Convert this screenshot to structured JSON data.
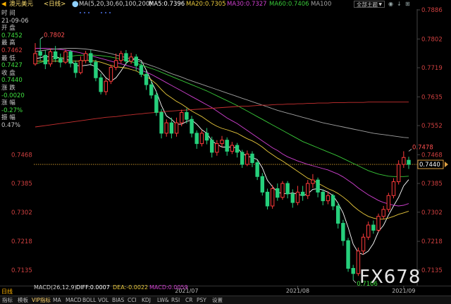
{
  "topbar": {
    "symbol_name": "澳元美元",
    "period_tag": "<日线>",
    "ma_title": "MA(5,20,30,60,100,200)",
    "ma_values": [
      {
        "label": "MA5:0.7396",
        "color": "#ffffff"
      },
      {
        "label": "MA20:0.7305",
        "color": "#e8c83c"
      },
      {
        "label": "MA30:0.7327",
        "color": "#d040d0"
      },
      {
        "label": "MA60:0.7406",
        "color": "#38c838"
      },
      {
        "label": "MA100",
        "color": "#a0a0a0"
      }
    ],
    "menu_button": "全部主题",
    "menu_caret": "▼",
    "icons": [
      "◉",
      "↓",
      "⊞"
    ]
  },
  "info_panel": {
    "lines": [
      {
        "text": "时 间",
        "color": "#c8c8c8"
      },
      {
        "text": "21-09-06",
        "color": "#c8c8c8"
      },
      {
        "text": "开 盘",
        "color": "#c8c8c8"
      },
      {
        "text": "0.7452",
        "color": "#40e040"
      },
      {
        "text": "最 高",
        "color": "#c8c8c8"
      },
      {
        "text": "0.7462",
        "color": "#e04040"
      },
      {
        "text": "最 低",
        "color": "#c8c8c8"
      },
      {
        "text": "0.7427",
        "color": "#40e040"
      },
      {
        "text": "收 盘",
        "color": "#c8c8c8"
      },
      {
        "text": "0.7440",
        "color": "#40e040"
      },
      {
        "text": "涨 跌",
        "color": "#c8c8c8"
      },
      {
        "text": "-0.0020",
        "color": "#40e040"
      },
      {
        "text": "涨 幅",
        "color": "#c8c8c8"
      },
      {
        "text": "-0.27%",
        "color": "#40e040"
      },
      {
        "text": "振 幅",
        "color": "#c8c8c8"
      },
      {
        "text": "0.47%",
        "color": "#c8c8c8"
      }
    ]
  },
  "chart_data": {
    "type": "candlestick",
    "ylim": [
      0.709,
      0.7886
    ],
    "y_ticks": [
      "0.7886",
      "0.7802",
      "0.7719",
      "0.7635",
      "0.7552",
      "0.7468",
      "0.7385",
      "0.7302",
      "0.7218",
      "0.7135"
    ],
    "y_tick_values": [
      0.7886,
      0.7802,
      0.7719,
      0.7635,
      0.7552,
      0.7468,
      0.7385,
      0.7302,
      0.7218,
      0.7135
    ],
    "left_ticks": [
      {
        "value": 0.7468,
        "label": "0.7468"
      },
      {
        "value": 0.7385,
        "label": "0.7385"
      },
      {
        "value": 0.7302,
        "label": "0.7302"
      },
      {
        "value": 0.7218,
        "label": "0.7218"
      },
      {
        "value": 0.7135,
        "label": "0.7135"
      }
    ],
    "x_labels": [
      {
        "label": "2021/07",
        "index": 30
      },
      {
        "label": "2021/08",
        "index": 52
      },
      {
        "label": "2021/09",
        "index": 73
      }
    ],
    "current_price": {
      "value": 0.744,
      "label": "0.7440"
    },
    "annotations": [
      {
        "label": "0.7802",
        "index": 1,
        "value": 0.7802,
        "kind": "high"
      },
      {
        "label": "0.7478",
        "index": 74,
        "value": 0.7478,
        "kind": "high"
      },
      {
        "label": "0.7106",
        "index": 63,
        "value": 0.7106,
        "kind": "low"
      }
    ],
    "candles": [
      [
        0.773,
        0.776,
        0.7725,
        0.779
      ],
      [
        0.7765,
        0.7755,
        0.774,
        0.7802
      ],
      [
        0.7755,
        0.773,
        0.7715,
        0.777
      ],
      [
        0.773,
        0.7765,
        0.7722,
        0.7775
      ],
      [
        0.7765,
        0.7745,
        0.7735,
        0.7782
      ],
      [
        0.7745,
        0.7735,
        0.772,
        0.776
      ],
      [
        0.7735,
        0.7765,
        0.773,
        0.7772
      ],
      [
        0.7765,
        0.7732,
        0.772,
        0.777
      ],
      [
        0.7732,
        0.7705,
        0.769,
        0.774
      ],
      [
        0.7705,
        0.774,
        0.77,
        0.7752
      ],
      [
        0.774,
        0.776,
        0.7732,
        0.7768
      ],
      [
        0.776,
        0.7735,
        0.7725,
        0.777
      ],
      [
        0.7735,
        0.769,
        0.768,
        0.7742
      ],
      [
        0.769,
        0.765,
        0.7642,
        0.7702
      ],
      [
        0.765,
        0.768,
        0.764,
        0.7688
      ],
      [
        0.768,
        0.772,
        0.7672,
        0.7728
      ],
      [
        0.772,
        0.774,
        0.7712,
        0.776
      ],
      [
        0.774,
        0.776,
        0.7732,
        0.7768
      ],
      [
        0.776,
        0.7738,
        0.7728,
        0.777
      ],
      [
        0.7738,
        0.775,
        0.773,
        0.7762
      ],
      [
        0.775,
        0.7725,
        0.771,
        0.7758
      ],
      [
        0.7725,
        0.77,
        0.7692,
        0.7735
      ],
      [
        0.77,
        0.767,
        0.7655,
        0.771
      ],
      [
        0.767,
        0.764,
        0.763,
        0.768
      ],
      [
        0.764,
        0.759,
        0.758,
        0.765
      ],
      [
        0.759,
        0.753,
        0.7515,
        0.76
      ],
      [
        0.753,
        0.756,
        0.752,
        0.757
      ],
      [
        0.756,
        0.753,
        0.7515,
        0.7575
      ],
      [
        0.753,
        0.756,
        0.752,
        0.7575
      ],
      [
        0.756,
        0.759,
        0.755,
        0.7598
      ],
      [
        0.759,
        0.757,
        0.7558,
        0.7602
      ],
      [
        0.757,
        0.753,
        0.7518,
        0.758
      ],
      [
        0.753,
        0.75,
        0.7485,
        0.7538
      ],
      [
        0.75,
        0.753,
        0.7492,
        0.754
      ],
      [
        0.753,
        0.751,
        0.7498,
        0.7545
      ],
      [
        0.751,
        0.7475,
        0.746,
        0.752
      ],
      [
        0.7475,
        0.75,
        0.7465,
        0.751
      ],
      [
        0.75,
        0.751,
        0.749,
        0.7522
      ],
      [
        0.751,
        0.7478,
        0.7465,
        0.7518
      ],
      [
        0.7478,
        0.7495,
        0.747,
        0.7505
      ],
      [
        0.7495,
        0.7475,
        0.746,
        0.7502
      ],
      [
        0.7475,
        0.744,
        0.743,
        0.7482
      ],
      [
        0.744,
        0.747,
        0.7435,
        0.748
      ],
      [
        0.747,
        0.7445,
        0.7432,
        0.7478
      ],
      [
        0.7445,
        0.7405,
        0.7395,
        0.7452
      ],
      [
        0.7405,
        0.736,
        0.735,
        0.7415
      ],
      [
        0.736,
        0.732,
        0.731,
        0.737
      ],
      [
        0.732,
        0.737,
        0.7312,
        0.738
      ],
      [
        0.737,
        0.7345,
        0.7335,
        0.7385
      ],
      [
        0.7345,
        0.7385,
        0.7338,
        0.7392
      ],
      [
        0.7385,
        0.7355,
        0.7342,
        0.7392
      ],
      [
        0.7355,
        0.733,
        0.7315,
        0.7368
      ],
      [
        0.733,
        0.736,
        0.7322,
        0.7378
      ],
      [
        0.736,
        0.735,
        0.7335,
        0.7378
      ],
      [
        0.735,
        0.7385,
        0.734,
        0.7395
      ],
      [
        0.7385,
        0.7395,
        0.7372,
        0.7412
      ],
      [
        0.7395,
        0.736,
        0.7345,
        0.7402
      ],
      [
        0.736,
        0.7335,
        0.7322,
        0.7368
      ],
      [
        0.7335,
        0.735,
        0.7325,
        0.7362
      ],
      [
        0.735,
        0.732,
        0.7308,
        0.7355
      ],
      [
        0.732,
        0.727,
        0.7255,
        0.733
      ],
      [
        0.727,
        0.722,
        0.7205,
        0.728
      ],
      [
        0.722,
        0.714,
        0.713,
        0.7228
      ],
      [
        0.714,
        0.7125,
        0.7106,
        0.715
      ],
      [
        0.7125,
        0.719,
        0.7118,
        0.72
      ],
      [
        0.719,
        0.723,
        0.718,
        0.724
      ],
      [
        0.723,
        0.7265,
        0.7222,
        0.7275
      ],
      [
        0.7265,
        0.725,
        0.724,
        0.7278
      ],
      [
        0.725,
        0.729,
        0.7245,
        0.7298
      ],
      [
        0.729,
        0.731,
        0.7282,
        0.732
      ],
      [
        0.731,
        0.735,
        0.7302,
        0.7358
      ],
      [
        0.735,
        0.739,
        0.7342,
        0.74
      ],
      [
        0.739,
        0.744,
        0.7382,
        0.7452
      ],
      [
        0.744,
        0.746,
        0.743,
        0.7478
      ],
      [
        0.7452,
        0.744,
        0.7427,
        0.7462
      ]
    ],
    "ma_lines": [
      {
        "name": "MA5",
        "color": "#ffffff",
        "values": [
          0.7745,
          0.7748,
          0.7752,
          0.775,
          0.7752,
          0.7746,
          0.7744,
          0.774,
          0.7726,
          0.7724,
          0.7726,
          0.7728,
          0.7722,
          0.7708,
          0.769,
          0.768,
          0.769,
          0.771,
          0.7732,
          0.7744,
          0.7745,
          0.774,
          0.7712,
          0.768,
          0.765,
          0.761,
          0.758,
          0.757,
          0.7556,
          0.7556,
          0.7564,
          0.7568,
          0.7556,
          0.754,
          0.753,
          0.7508,
          0.7498,
          0.749,
          0.749,
          0.749,
          0.7488,
          0.7472,
          0.7464,
          0.746,
          0.7454,
          0.743,
          0.7394,
          0.7376,
          0.736,
          0.7356,
          0.7355,
          0.7358,
          0.7354,
          0.735,
          0.7355,
          0.7368,
          0.737,
          0.7366,
          0.736,
          0.735,
          0.7328,
          0.73,
          0.7258,
          0.721,
          0.7185,
          0.718,
          0.719,
          0.7212,
          0.7246,
          0.7264,
          0.7294,
          0.732,
          0.7345,
          0.7378,
          0.7396
        ]
      },
      {
        "name": "MA20",
        "color": "#e8c83c",
        "values": [
          0.7738,
          0.7738,
          0.7738,
          0.7738,
          0.7738,
          0.7738,
          0.7738,
          0.7738,
          0.7738,
          0.7738,
          0.774,
          0.774,
          0.7738,
          0.7735,
          0.773,
          0.7725,
          0.7722,
          0.772,
          0.7718,
          0.7714,
          0.771,
          0.7702,
          0.7694,
          0.7684,
          0.7672,
          0.7656,
          0.7642,
          0.7632,
          0.7622,
          0.7614,
          0.7604,
          0.7594,
          0.7586,
          0.7578,
          0.7568,
          0.7558,
          0.755,
          0.7544,
          0.754,
          0.7535,
          0.753,
          0.7522,
          0.7514,
          0.7508,
          0.75,
          0.749,
          0.7478,
          0.7468,
          0.7458,
          0.745,
          0.744,
          0.743,
          0.742,
          0.741,
          0.74,
          0.7394,
          0.7386,
          0.7378,
          0.737,
          0.7364,
          0.7356,
          0.7346,
          0.7334,
          0.732,
          0.7308,
          0.7298,
          0.729,
          0.7285,
          0.7282,
          0.7282,
          0.7285,
          0.729,
          0.7296,
          0.73,
          0.7305
        ]
      },
      {
        "name": "MA30",
        "color": "#d040d0",
        "values": [
          0.7775,
          0.7775,
          0.7775,
          0.7774,
          0.7773,
          0.7772,
          0.777,
          0.7768,
          0.7765,
          0.7762,
          0.7758,
          0.7754,
          0.775,
          0.7746,
          0.7742,
          0.7738,
          0.7734,
          0.773,
          0.7726,
          0.7722,
          0.7718,
          0.7712,
          0.7706,
          0.77,
          0.7692,
          0.7684,
          0.7676,
          0.7668,
          0.766,
          0.7652,
          0.7644,
          0.7636,
          0.7628,
          0.762,
          0.7612,
          0.7604,
          0.7594,
          0.7584,
          0.7574,
          0.7566,
          0.7558,
          0.7548,
          0.7538,
          0.7528,
          0.7518,
          0.7508,
          0.7498,
          0.7488,
          0.748,
          0.747,
          0.7462,
          0.7456,
          0.745,
          0.7445,
          0.744,
          0.7436,
          0.7432,
          0.7428,
          0.7424,
          0.7418,
          0.7412,
          0.7404,
          0.7394,
          0.7384,
          0.7372,
          0.7362,
          0.7352,
          0.7344,
          0.7336,
          0.733,
          0.7326,
          0.7322,
          0.732,
          0.7322,
          0.7327
        ]
      },
      {
        "name": "MA60",
        "color": "#38c838",
        "values": [
          0.773,
          0.7734,
          0.7738,
          0.7742,
          0.7745,
          0.7748,
          0.775,
          0.7752,
          0.7754,
          0.7755,
          0.7756,
          0.7756,
          0.7755,
          0.7754,
          0.7752,
          0.775,
          0.7747,
          0.7744,
          0.774,
          0.7736,
          0.7732,
          0.7727,
          0.7722,
          0.7717,
          0.7712,
          0.7706,
          0.77,
          0.7694,
          0.7688,
          0.7682,
          0.7676,
          0.767,
          0.7664,
          0.7658,
          0.7652,
          0.7645,
          0.7638,
          0.7631,
          0.7624,
          0.7617,
          0.761,
          0.7602,
          0.7594,
          0.7586,
          0.7578,
          0.757,
          0.7562,
          0.7554,
          0.7546,
          0.7538,
          0.753,
          0.7522,
          0.7514,
          0.7506,
          0.75,
          0.7494,
          0.7488,
          0.7482,
          0.7476,
          0.747,
          0.7464,
          0.7457,
          0.745,
          0.7443,
          0.7436,
          0.7429,
          0.7422,
          0.7417,
          0.7412,
          0.7409,
          0.7406,
          0.7405,
          0.7405,
          0.7405,
          0.7406
        ]
      },
      {
        "name": "MA100",
        "color": "#a0a0a0",
        "values": [
          0.7765,
          0.7768,
          0.777,
          0.7772,
          0.7773,
          0.7774,
          0.7775,
          0.7775,
          0.7775,
          0.7774,
          0.7773,
          0.7771,
          0.7769,
          0.7766,
          0.7763,
          0.776,
          0.7756,
          0.7752,
          0.7748,
          0.7744,
          0.774,
          0.7735,
          0.773,
          0.7725,
          0.772,
          0.7714,
          0.7708,
          0.7702,
          0.7697,
          0.7692,
          0.7686,
          0.7681,
          0.7676,
          0.7671,
          0.7666,
          0.7661,
          0.7656,
          0.7651,
          0.7646,
          0.7641,
          0.7636,
          0.7631,
          0.7626,
          0.7621,
          0.7616,
          0.7611,
          0.7606,
          0.7601,
          0.7596,
          0.7592,
          0.7588,
          0.7584,
          0.758,
          0.7576,
          0.7572,
          0.7568,
          0.7564,
          0.756,
          0.7557,
          0.7554,
          0.7551,
          0.7548,
          0.7545,
          0.7542,
          0.7539,
          0.7536,
          0.7533,
          0.753,
          0.7528,
          0.7526,
          0.7524,
          0.7522,
          0.752,
          0.7518,
          0.7517
        ]
      },
      {
        "name": "MA200",
        "color": "#c83030",
        "values": [
          0.7548,
          0.755,
          0.7552,
          0.7554,
          0.7556,
          0.7558,
          0.756,
          0.7562,
          0.7564,
          0.7566,
          0.7568,
          0.757,
          0.7572,
          0.7574,
          0.7576,
          0.7577,
          0.7578,
          0.758,
          0.7582,
          0.7583,
          0.7585,
          0.7586,
          0.7588,
          0.7589,
          0.759,
          0.7592,
          0.7593,
          0.7594,
          0.7595,
          0.7596,
          0.7597,
          0.7598,
          0.7599,
          0.76,
          0.7601,
          0.7602,
          0.7603,
          0.7604,
          0.7605,
          0.7606,
          0.7607,
          0.7608,
          0.7608,
          0.7609,
          0.761,
          0.7611,
          0.7611,
          0.7612,
          0.7613,
          0.7613,
          0.7614,
          0.7614,
          0.7615,
          0.7615,
          0.7616,
          0.7616,
          0.7617,
          0.7617,
          0.7617,
          0.7618,
          0.7618,
          0.7618,
          0.7619,
          0.7619,
          0.7619,
          0.7619,
          0.762,
          0.762,
          0.762,
          0.762,
          0.762,
          0.762,
          0.762,
          0.762,
          0.762
        ]
      }
    ]
  },
  "macd_bar": {
    "title": "MACD(26,12,9)",
    "diff": "DIFF:0.0007",
    "dea": "DEA:-0.0022",
    "macd": "MACD:0.0059"
  },
  "bottom": {
    "period_badge": "日线",
    "watermark": "FX678",
    "tabs": [
      "指标",
      "模板",
      "VIP指标",
      "MA",
      "MACD",
      "BOLL",
      "VOL",
      "BIAS",
      "CCI",
      "KDJ",
      "LW&",
      "RSI",
      "CR",
      "PSY",
      "设置"
    ]
  },
  "colors": {
    "up": "#ff3b3b",
    "down": "#26d07c",
    "grid_dot": "#4060c0",
    "current_line": "#d8a030",
    "axis_text": "#d04040",
    "axis_line": "#444"
  }
}
